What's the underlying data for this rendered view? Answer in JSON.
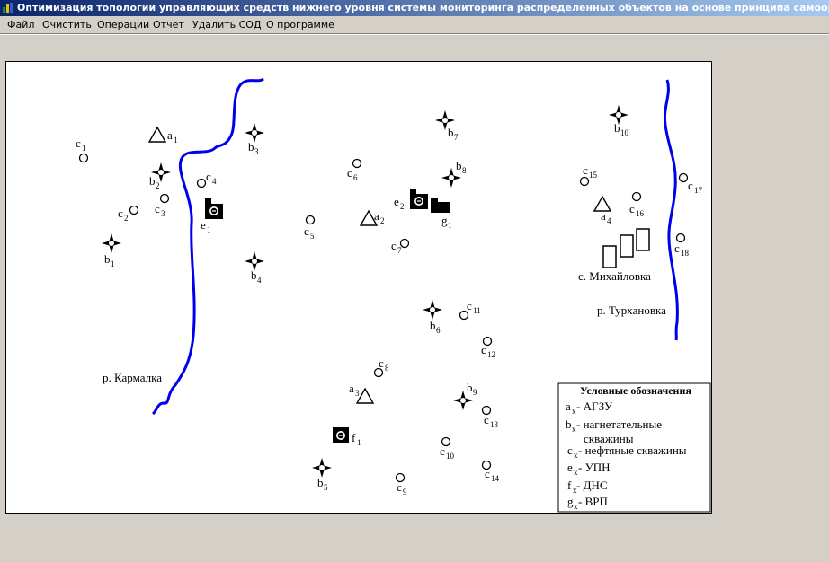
{
  "window": {
    "title": "Оптимизация топологии управляющих средств нижнего уровня системы мониторинга распределенных объектов на основе принципа самоорганизации",
    "icon": "app-icon"
  },
  "menu": [
    {
      "label": "Файл"
    },
    {
      "label": "Очистить"
    },
    {
      "label": "Операции"
    },
    {
      "label": "Отчет"
    },
    {
      "label": "Удалить СОД"
    },
    {
      "label": "О программе"
    }
  ],
  "map": {
    "labels": {
      "river_karmalka": "р. Кармалка",
      "river_turkhanovka": "р. Турхановка",
      "village": "с. Михайловка"
    },
    "agzu": [
      {
        "n": "a",
        "i": "1"
      },
      {
        "n": "a",
        "i": "2"
      },
      {
        "n": "a",
        "i": "3"
      },
      {
        "n": "a",
        "i": "4"
      }
    ],
    "injection_wells": [
      {
        "n": "b",
        "i": "1"
      },
      {
        "n": "b",
        "i": "2"
      },
      {
        "n": "b",
        "i": "3"
      },
      {
        "n": "b",
        "i": "4"
      },
      {
        "n": "b",
        "i": "5"
      },
      {
        "n": "b",
        "i": "6"
      },
      {
        "n": "b",
        "i": "7"
      },
      {
        "n": "b",
        "i": "8"
      },
      {
        "n": "b",
        "i": "9"
      },
      {
        "n": "b",
        "i": "10"
      }
    ],
    "oil_wells": [
      {
        "n": "c",
        "i": "1"
      },
      {
        "n": "c",
        "i": "2"
      },
      {
        "n": "c",
        "i": "3"
      },
      {
        "n": "c",
        "i": "4"
      },
      {
        "n": "c",
        "i": "5"
      },
      {
        "n": "c",
        "i": "6"
      },
      {
        "n": "c",
        "i": "7"
      },
      {
        "n": "c",
        "i": "8"
      },
      {
        "n": "c",
        "i": "9"
      },
      {
        "n": "c",
        "i": "10"
      },
      {
        "n": "c",
        "i": "11"
      },
      {
        "n": "c",
        "i": "12"
      },
      {
        "n": "c",
        "i": "13"
      },
      {
        "n": "c",
        "i": "14"
      },
      {
        "n": "c",
        "i": "15"
      },
      {
        "n": "c",
        "i": "16"
      },
      {
        "n": "c",
        "i": "17"
      },
      {
        "n": "c",
        "i": "18"
      }
    ],
    "upn": [
      {
        "n": "e",
        "i": "1"
      },
      {
        "n": "e",
        "i": "2"
      }
    ],
    "dns": [
      {
        "n": "f",
        "i": "1"
      }
    ],
    "vrp": [
      {
        "n": "g",
        "i": "1"
      }
    ]
  },
  "legend": {
    "title": "Условные обозначения",
    "items": [
      {
        "sym": "a",
        "sub": "x",
        "text": "- АГЗУ"
      },
      {
        "sym": "b",
        "sub": "x",
        "text": "- нагнетательные",
        "text2": "скважины"
      },
      {
        "sym": "c",
        "sub": "x",
        "text": "- нефтяные скважины"
      },
      {
        "sym": "e",
        "sub": "x",
        "text": "- УПН"
      },
      {
        "sym": "f",
        "sub": "x",
        "text": "- ДНС"
      },
      {
        "sym": "g",
        "sub": "x",
        "text": "- ВРП"
      }
    ]
  },
  "colors": {
    "river": "#0000ee",
    "titlebar_start": "#0a246a",
    "titlebar_end": "#a6caf0",
    "window_bg": "#d4d0c8"
  }
}
